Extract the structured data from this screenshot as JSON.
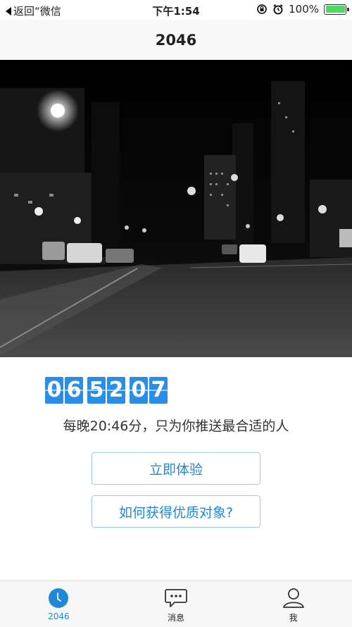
{
  "status_bar": {
    "back_label": "返回“微信",
    "time": "下午1:54",
    "battery_percent": "100%",
    "battery_level": 1.0,
    "icons": [
      "lock-rotation-icon",
      "alarm-icon",
      "battery-icon"
    ]
  },
  "nav": {
    "title": "2046"
  },
  "hero": {
    "description_icon": "night-street-photo"
  },
  "countdown": {
    "hours": "06",
    "minutes": "52",
    "seconds": "07"
  },
  "tagline": "每晚20:46分，只为你推送最合适的人",
  "buttons": {
    "try_now": "立即体验",
    "how_to": "如何获得优质对象?"
  },
  "tabs": [
    {
      "label": "2046",
      "icon": "clock-icon",
      "active": true
    },
    {
      "label": "消息",
      "icon": "chat-bubble-icon",
      "active": false
    },
    {
      "label": "我",
      "icon": "person-icon",
      "active": false
    }
  ],
  "colors": {
    "accent": "#1f88d8",
    "digit_bg": "#2a8ee6",
    "battery": "#4cd964"
  }
}
